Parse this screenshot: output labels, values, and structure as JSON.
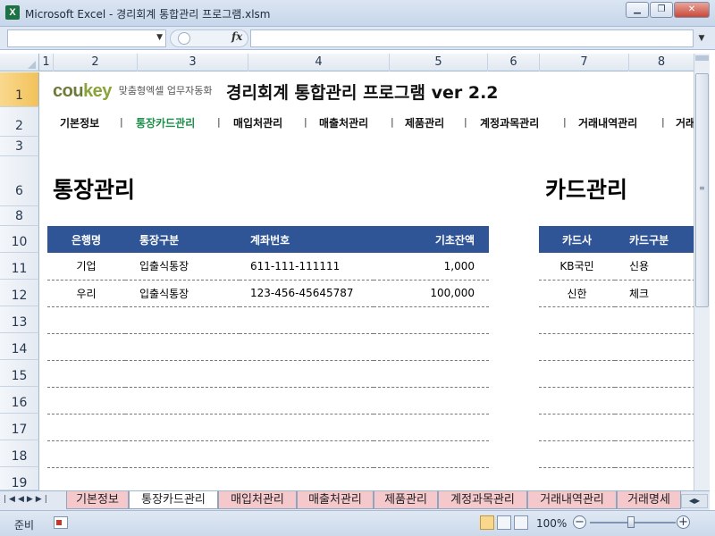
{
  "window": {
    "title": "Microsoft Excel - 경리회계 통합관리 프로그램.xlsm",
    "app_icon": "X"
  },
  "formula_bar": {
    "name_box": "",
    "fx": "fx",
    "formula": ""
  },
  "columns": [
    "1",
    "2",
    "3",
    "4",
    "5",
    "6",
    "7",
    "8"
  ],
  "rows": [
    "1",
    "2",
    "3",
    "6",
    "8",
    "10",
    "11",
    "12",
    "13",
    "14",
    "15",
    "16",
    "17",
    "18",
    "19"
  ],
  "selected_row": "1",
  "brand": {
    "logo_part1": "cou",
    "logo_part2": "key",
    "tagline": "맞춤형엑셀 업무자동화"
  },
  "app_title": "경리회계 통합관리 프로그램 ver 2.2",
  "nav": {
    "items": [
      "기본정보",
      "통장카드관리",
      "매입처관리",
      "매출처관리",
      "제품관리",
      "계정과목관리",
      "거래내역관리",
      "거래"
    ],
    "active_index": 1,
    "separator": "|"
  },
  "bank_section": {
    "title": "통장관리",
    "headers": [
      "은행명",
      "통장구분",
      "계좌번호",
      "기초잔액"
    ],
    "rows": [
      [
        "기업",
        "입출식통장",
        "611-111-111111",
        "1,000"
      ],
      [
        "우리",
        "입출식통장",
        "123-456-45645787",
        "100,000"
      ],
      [
        "",
        "",
        "",
        ""
      ],
      [
        "",
        "",
        "",
        ""
      ],
      [
        "",
        "",
        "",
        ""
      ],
      [
        "",
        "",
        "",
        ""
      ],
      [
        "",
        "",
        "",
        ""
      ],
      [
        "",
        "",
        "",
        ""
      ]
    ]
  },
  "card_section": {
    "title": "카드관리",
    "headers": [
      "카드사",
      "카드구분"
    ],
    "rows": [
      [
        "KB국민",
        "신용"
      ],
      [
        "신한",
        "체크"
      ],
      [
        "",
        ""
      ],
      [
        "",
        ""
      ],
      [
        "",
        ""
      ],
      [
        "",
        ""
      ],
      [
        "",
        ""
      ],
      [
        "",
        ""
      ]
    ]
  },
  "sheet_tabs": [
    "기본정보",
    "통장카드관리",
    "매입처관리",
    "매출처관리",
    "제품관리",
    "계정과목관리",
    "거래내역관리",
    "거래명세"
  ],
  "active_sheet_index": 1,
  "status": {
    "ready": "준비",
    "zoom": "100%"
  },
  "colors": {
    "header_blue": "#2f5597",
    "active_nav": "#1e8f4a",
    "tab_pink": "#f5c9cc",
    "selected_row": "#f2c25a"
  }
}
